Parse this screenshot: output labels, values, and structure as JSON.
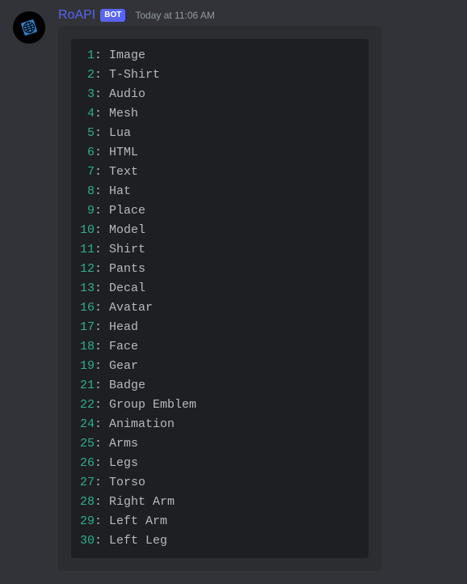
{
  "message": {
    "username": "RoAPI",
    "bot_tag": "BOT",
    "timestamp": "Today at 11:06 AM"
  },
  "code_lines": [
    {
      "num": "1",
      "value": "Image"
    },
    {
      "num": "2",
      "value": "T-Shirt"
    },
    {
      "num": "3",
      "value": "Audio"
    },
    {
      "num": "4",
      "value": "Mesh"
    },
    {
      "num": "5",
      "value": "Lua"
    },
    {
      "num": "6",
      "value": "HTML"
    },
    {
      "num": "7",
      "value": "Text"
    },
    {
      "num": "8",
      "value": "Hat"
    },
    {
      "num": "9",
      "value": "Place"
    },
    {
      "num": "10",
      "value": "Model"
    },
    {
      "num": "11",
      "value": "Shirt"
    },
    {
      "num": "12",
      "value": "Pants"
    },
    {
      "num": "13",
      "value": "Decal"
    },
    {
      "num": "16",
      "value": "Avatar"
    },
    {
      "num": "17",
      "value": "Head"
    },
    {
      "num": "18",
      "value": "Face"
    },
    {
      "num": "19",
      "value": "Gear"
    },
    {
      "num": "21",
      "value": "Badge"
    },
    {
      "num": "22",
      "value": "Group Emblem"
    },
    {
      "num": "24",
      "value": "Animation"
    },
    {
      "num": "25",
      "value": "Arms"
    },
    {
      "num": "26",
      "value": "Legs"
    },
    {
      "num": "27",
      "value": "Torso"
    },
    {
      "num": "28",
      "value": "Right Arm"
    },
    {
      "num": "29",
      "value": "Left Arm"
    },
    {
      "num": "30",
      "value": "Left Leg"
    }
  ],
  "number_pad_width": 2
}
